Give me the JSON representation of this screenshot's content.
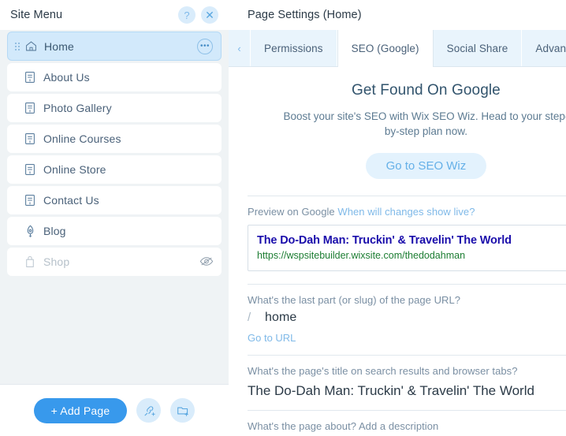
{
  "sidebar": {
    "title": "Site Menu",
    "help_icon": "question-mark-icon",
    "help_label": "?",
    "close_label": "✕",
    "items": [
      {
        "label": "Home",
        "icon": "home-icon",
        "active": true,
        "hidden": false,
        "has_dots": true,
        "has_eye": false
      },
      {
        "label": "About Us",
        "icon": "page-icon",
        "active": false,
        "hidden": false,
        "has_dots": false,
        "has_eye": false
      },
      {
        "label": "Photo Gallery",
        "icon": "page-icon",
        "active": false,
        "hidden": false,
        "has_dots": false,
        "has_eye": false
      },
      {
        "label": "Online Courses",
        "icon": "page-icon",
        "active": false,
        "hidden": false,
        "has_dots": false,
        "has_eye": false
      },
      {
        "label": "Online Store",
        "icon": "page-icon",
        "active": false,
        "hidden": false,
        "has_dots": false,
        "has_eye": false
      },
      {
        "label": "Contact Us",
        "icon": "page-icon",
        "active": false,
        "hidden": false,
        "has_dots": false,
        "has_eye": false
      },
      {
        "label": "Blog",
        "icon": "pen-nib-icon",
        "active": false,
        "hidden": false,
        "has_dots": false,
        "has_eye": false
      },
      {
        "label": "Shop",
        "icon": "shopping-bag-icon",
        "active": false,
        "hidden": true,
        "has_dots": false,
        "has_eye": true
      }
    ],
    "footer": {
      "add_page_label": "+ Add Page",
      "link_icon": "add-link-icon",
      "folder_icon": "add-folder-icon"
    },
    "more_options_label": "•••"
  },
  "panel": {
    "title": "Page Settings (Home)",
    "help_label": "?",
    "back_label": "‹",
    "tabs_scroll_left_label": "‹",
    "tabs": [
      {
        "label": "Permissions",
        "active": false
      },
      {
        "label": "SEO (Google)",
        "active": true
      },
      {
        "label": "Social Share",
        "active": false
      },
      {
        "label": "Advanced SEO",
        "active": false
      }
    ],
    "promo": {
      "title": "Get Found On Google",
      "subtitle": "Boost your site's SEO with Wix SEO Wiz. Head to your step-by-step plan now.",
      "button_label": "Go to SEO Wiz"
    },
    "preview": {
      "label": "Preview on Google",
      "link_label": "When will changes show live?",
      "result_title": "The Do-Dah Man: Truckin' & Travelin' The World",
      "result_url": "https://wspsitebuilder.wixsite.com/thedodahman"
    },
    "slug": {
      "label": "What's the last part (or slug) of the page URL?",
      "prefix": "/",
      "value": "home",
      "goto_label": "Go to URL"
    },
    "page_title": {
      "label": "What's the page's title on search results and browser tabs?",
      "value": "The Do-Dah Man: Truckin' & Travelin' The World"
    },
    "description": {
      "label": "What's the page about? Add a description"
    }
  },
  "colors": {
    "accent": "#3899ec",
    "panel_bg": "#ffffff",
    "sidebar_bg": "#eff3f5",
    "tab_inactive": "#e9f4fc",
    "google_title": "#1a0dab",
    "google_url": "#1c7d32"
  }
}
